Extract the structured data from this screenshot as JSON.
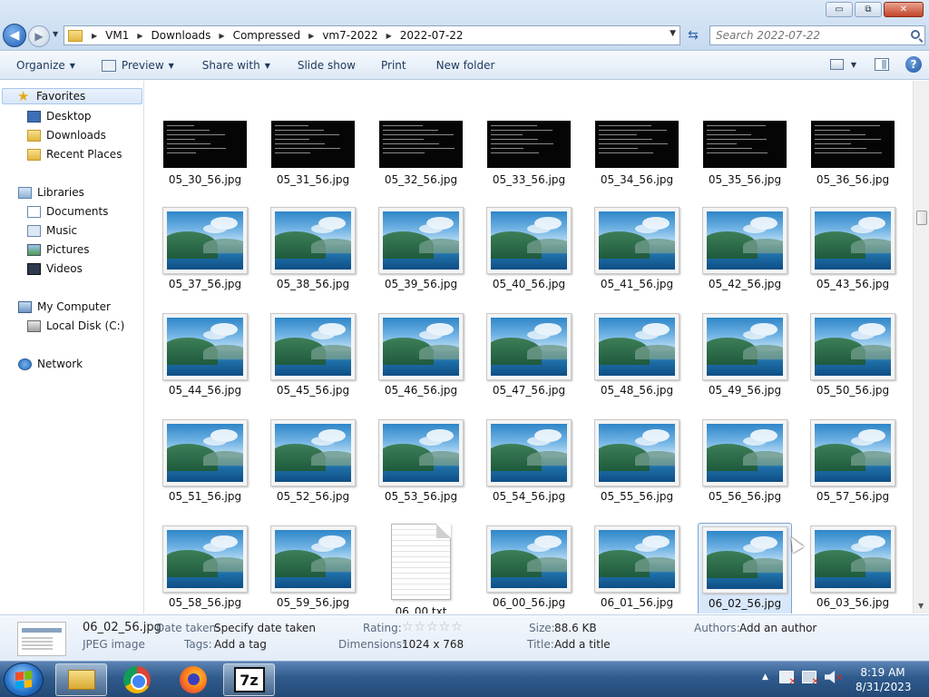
{
  "window": {
    "controls": {
      "minimize": "▭",
      "maximize": "⧉",
      "close": "✕"
    }
  },
  "address": {
    "crumbs": [
      "VM1",
      "Downloads",
      "Compressed",
      "vm7-2022",
      "2022-07-22"
    ]
  },
  "search": {
    "placeholder": "Search 2022-07-22"
  },
  "toolbar": {
    "organize": "Organize",
    "preview": "Preview",
    "share_with": "Share with",
    "slide_show": "Slide show",
    "print": "Print",
    "new_folder": "New folder"
  },
  "navpane": {
    "favorites": "Favorites",
    "desktop": "Desktop",
    "downloads": "Downloads",
    "recent_places": "Recent Places",
    "libraries": "Libraries",
    "documents": "Documents",
    "music": "Music",
    "pictures": "Pictures",
    "videos": "Videos",
    "my_computer": "My Computer",
    "local_disk": "Local Disk (C:)",
    "network": "Network"
  },
  "files": [
    {
      "name": "05_30_56.jpg",
      "kind": "dark"
    },
    {
      "name": "05_31_56.jpg",
      "kind": "dark"
    },
    {
      "name": "05_32_56.jpg",
      "kind": "dark"
    },
    {
      "name": "05_33_56.jpg",
      "kind": "dark"
    },
    {
      "name": "05_34_56.jpg",
      "kind": "dark"
    },
    {
      "name": "05_35_56.jpg",
      "kind": "dark"
    },
    {
      "name": "05_36_56.jpg",
      "kind": "dark"
    },
    {
      "name": "05_37_56.jpg",
      "kind": "photo"
    },
    {
      "name": "05_38_56.jpg",
      "kind": "photo"
    },
    {
      "name": "05_39_56.jpg",
      "kind": "photo"
    },
    {
      "name": "05_40_56.jpg",
      "kind": "photo"
    },
    {
      "name": "05_41_56.jpg",
      "kind": "photo"
    },
    {
      "name": "05_42_56.jpg",
      "kind": "photo"
    },
    {
      "name": "05_43_56.jpg",
      "kind": "photo"
    },
    {
      "name": "05_44_56.jpg",
      "kind": "photo"
    },
    {
      "name": "05_45_56.jpg",
      "kind": "photo"
    },
    {
      "name": "05_46_56.jpg",
      "kind": "photo"
    },
    {
      "name": "05_47_56.jpg",
      "kind": "photo"
    },
    {
      "name": "05_48_56.jpg",
      "kind": "photo"
    },
    {
      "name": "05_49_56.jpg",
      "kind": "photo"
    },
    {
      "name": "05_50_56.jpg",
      "kind": "photo"
    },
    {
      "name": "05_51_56.jpg",
      "kind": "photo"
    },
    {
      "name": "05_52_56.jpg",
      "kind": "photo"
    },
    {
      "name": "05_53_56.jpg",
      "kind": "photo"
    },
    {
      "name": "05_54_56.jpg",
      "kind": "photo"
    },
    {
      "name": "05_55_56.jpg",
      "kind": "photo"
    },
    {
      "name": "05_56_56.jpg",
      "kind": "photo"
    },
    {
      "name": "05_57_56.jpg",
      "kind": "photo"
    },
    {
      "name": "05_58_56.jpg",
      "kind": "photo"
    },
    {
      "name": "05_59_56.jpg",
      "kind": "photo"
    },
    {
      "name": "06_00.txt",
      "kind": "txt"
    },
    {
      "name": "06_00_56.jpg",
      "kind": "photo"
    },
    {
      "name": "06_01_56.jpg",
      "kind": "photo"
    },
    {
      "name": "06_02_56.jpg",
      "kind": "photo",
      "selected": true
    },
    {
      "name": "06_03_56.jpg",
      "kind": "photo"
    }
  ],
  "details": {
    "filename": "06_02_56.jpg",
    "filetype": "JPEG image",
    "date_taken_label": "Date taken:",
    "date_taken_value": "Specify date taken",
    "tags_label": "Tags:",
    "tags_value": "Add a tag",
    "rating_label": "Rating:",
    "rating_stars": "☆☆☆☆☆",
    "dimensions_label": "Dimensions:",
    "dimensions_value": "1024 x 768",
    "size_label": "Size:",
    "size_value": "88.6 KB",
    "title_label": "Title:",
    "title_value": "Add a title",
    "authors_label": "Authors:",
    "authors_value": "Add an author"
  },
  "taskbar": {
    "seven_zip_label": "7z",
    "time": "8:19 AM",
    "date": "8/31/2023"
  }
}
